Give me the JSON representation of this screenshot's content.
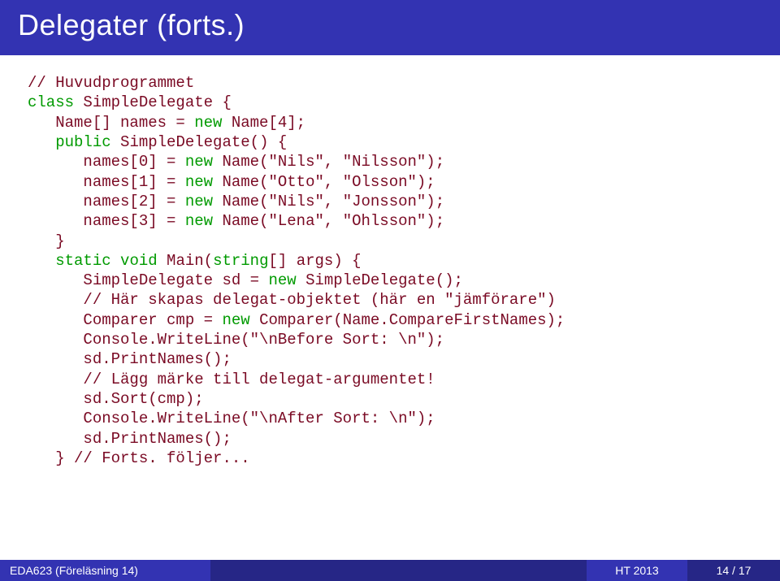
{
  "title": "Delegater (forts.)",
  "code": {
    "c1": "// Huvudprogrammet",
    "kw_class": "class",
    "c2": " SimpleDelegate {",
    "c3": "   Name[] names = ",
    "kw_new1": "new",
    "c4": " Name[4];",
    "c5": "   ",
    "kw_public": "public",
    "c6": " SimpleDelegate() {",
    "c7": "      names[0] = ",
    "kw_new2": "new",
    "c8": " Name(\"Nils\", \"Nilsson\");",
    "c9": "      names[1] = ",
    "kw_new3": "new",
    "c10": " Name(\"Otto\", \"Olsson\");",
    "c11": "      names[2] = ",
    "kw_new4": "new",
    "c12": " Name(\"Nils\", \"Jonsson\");",
    "c13": "      names[3] = ",
    "kw_new5": "new",
    "c14": " Name(\"Lena\", \"Ohlsson\");",
    "c15": "   }",
    "c16": "   ",
    "kw_static": "static",
    "kw_void": "void",
    "c17": " Main(",
    "kw_string": "string",
    "c18": "[] args) {",
    "c19": "      SimpleDelegate sd = ",
    "kw_new6": "new",
    "c20": " SimpleDelegate();",
    "c21": "      // Här skapas delegat-objektet (här en \"jämförare\")",
    "c22": "      Comparer cmp = ",
    "kw_new7": "new",
    "c23": " Comparer(Name.CompareFirstNames);",
    "c24": "      Console.WriteLine(\"\\nBefore Sort: \\n\");",
    "c25": "      sd.PrintNames();",
    "c26": "      // Lägg märke till delegat-argumentet!",
    "c27": "      sd.Sort(cmp);",
    "c28": "      Console.WriteLine(\"\\nAfter Sort: \\n\");",
    "c29": "      sd.PrintNames();",
    "c30": "   } // Forts. följer..."
  },
  "footer": {
    "left": "EDA623 (Föreläsning 14)",
    "right1": "HT 2013",
    "right2": "14 / 17"
  }
}
